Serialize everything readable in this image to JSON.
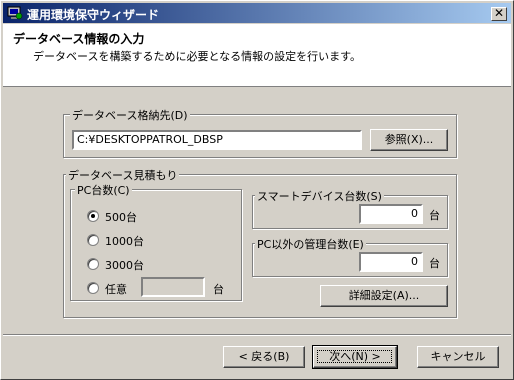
{
  "window": {
    "title": "運用環境保守ウィザード",
    "close_glyph": "✕"
  },
  "header": {
    "title": "データベース情報の入力",
    "subtitle": "データベースを構築するために必要となる情報の設定を行います。"
  },
  "db_location": {
    "legend": "データベース格納先(D)",
    "path_value": "C:¥DESKTOPPATROL_DBSP",
    "browse_label": "参照(X)..."
  },
  "estimate": {
    "legend": "データベース見積もり",
    "pc_count": {
      "legend": "PC台数(C)",
      "options": [
        {
          "label": "500台",
          "checked": true
        },
        {
          "label": "1000台",
          "checked": false
        },
        {
          "label": "3000台",
          "checked": false
        },
        {
          "label": "任意",
          "checked": false
        }
      ],
      "custom_value": "",
      "custom_unit": "台"
    },
    "smart_device": {
      "legend": "スマートデバイス台数(S)",
      "value": "0",
      "unit": "台"
    },
    "non_pc": {
      "legend": "PC以外の管理台数(E)",
      "value": "0",
      "unit": "台"
    },
    "detail_button": "詳細設定(A)..."
  },
  "footer": {
    "back_label": "< 戻る(B)",
    "next_label": "次へ(N) >",
    "cancel_label": "キャンセル"
  }
}
